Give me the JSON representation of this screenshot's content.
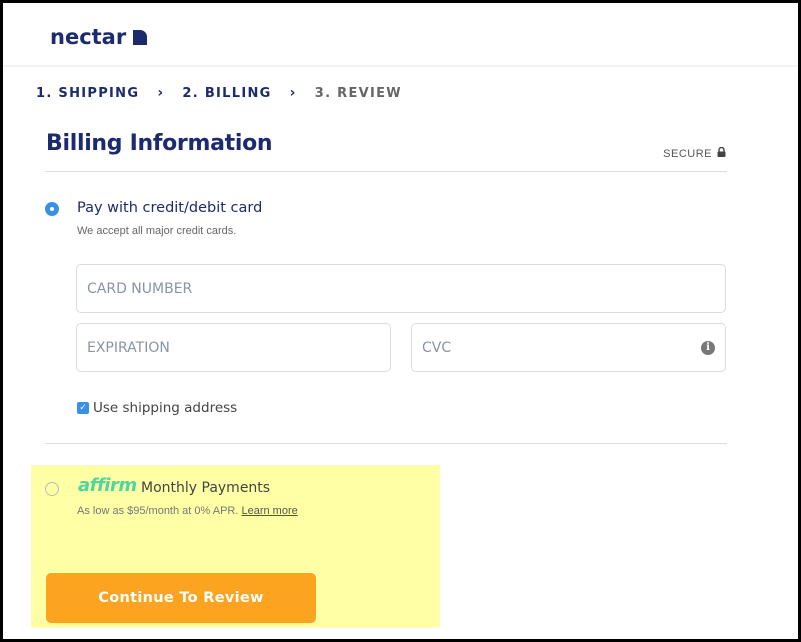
{
  "header": {
    "logo_text": "nectar"
  },
  "steps": [
    {
      "label": "1. SHIPPING",
      "state": "complete"
    },
    {
      "label": "2. BILLING",
      "state": "active"
    },
    {
      "label": "3. REVIEW",
      "state": "upcoming"
    }
  ],
  "step_separator": "›",
  "billing": {
    "title": "Billing Information",
    "secure_label": "SECURE",
    "card_option": {
      "label": "Pay with credit/debit card",
      "subtext": "We accept all major credit cards.",
      "selected": true
    },
    "fields": {
      "card_number_placeholder": "CARD NUMBER",
      "expiration_placeholder": "EXPIRATION",
      "cvc_placeholder": "CVC"
    },
    "use_shipping_address": {
      "label": "Use shipping address",
      "checked": true
    },
    "affirm_option": {
      "brand": "affirm",
      "label": "Monthly Payments",
      "subtext": "As low as $95/month at 0% APR.",
      "link": "Learn more",
      "selected": false
    },
    "continue_button": "Continue To Review"
  },
  "colors": {
    "brand_navy": "#1c2a6e",
    "accent_blue": "#3a8fe8",
    "cta_orange": "#fca31f",
    "affirm_green": "#4fd6a0",
    "highlight_yellow": "#ffffa6"
  }
}
